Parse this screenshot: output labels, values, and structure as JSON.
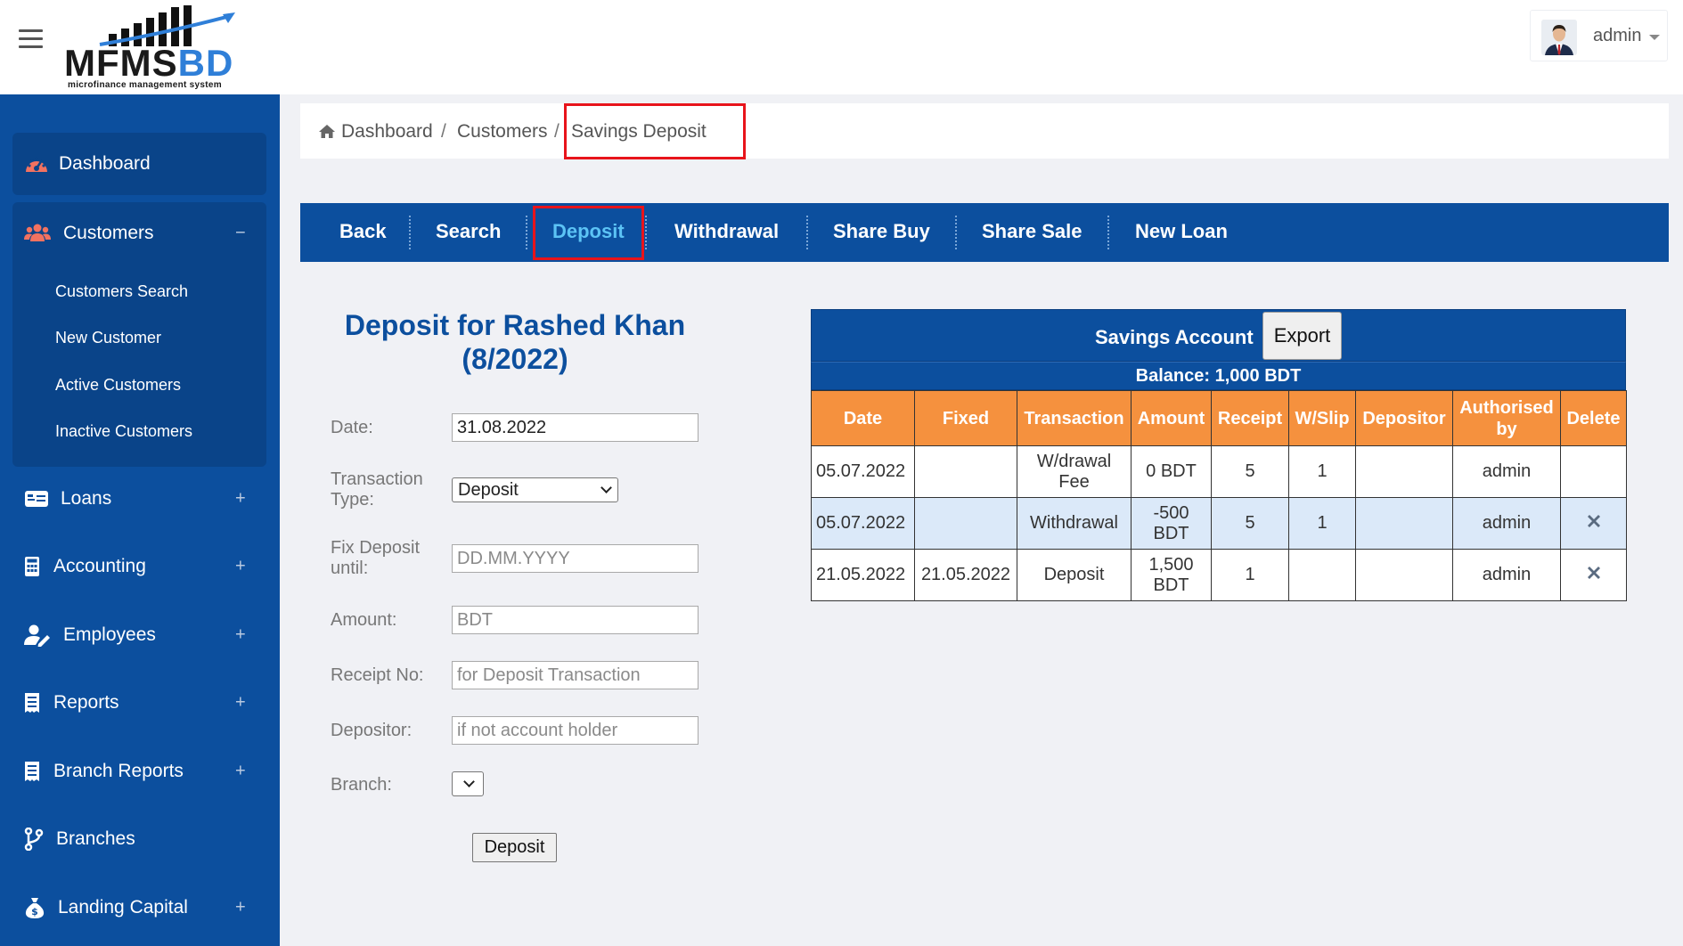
{
  "header": {
    "logo_main_dark": "MFMS",
    "logo_main_blue": "BD",
    "logo_sub": "microfinance management system",
    "user_name": "admin"
  },
  "sidebar": {
    "dashboard": "Dashboard",
    "customers": "Customers",
    "customers_toggle": "−",
    "customer_sub": [
      "Customers Search",
      "New Customer",
      "Active Customers",
      "Inactive Customers"
    ],
    "items": [
      {
        "label": "Loans",
        "toggle": "+"
      },
      {
        "label": "Accounting",
        "toggle": "+"
      },
      {
        "label": "Employees",
        "toggle": "+"
      },
      {
        "label": "Reports",
        "toggle": "+"
      },
      {
        "label": "Branch Reports",
        "toggle": "+"
      },
      {
        "label": "Branches",
        "toggle": ""
      },
      {
        "label": "Landing Capital",
        "toggle": "+"
      }
    ]
  },
  "breadcrumb": {
    "home": "Dashboard",
    "sep": "/",
    "customers": "Customers",
    "current": "Savings Deposit"
  },
  "actions": [
    "Back",
    "Search",
    "Deposit",
    "Withdrawal",
    "Share Buy",
    "Share Sale",
    "New Loan"
  ],
  "form": {
    "title_line1": "Deposit for Rashed Khan",
    "title_line2": "(8/2022)",
    "date_label": "Date:",
    "date_value": "31.08.2022",
    "type_label_1": "Transaction",
    "type_label_2": "Type:",
    "type_value": "Deposit",
    "fix_label_1": "Fix Deposit",
    "fix_label_2": "until:",
    "fix_placeholder": "DD.MM.YYYY",
    "amount_label": "Amount:",
    "amount_placeholder": "BDT",
    "receipt_label": "Receipt No:",
    "receipt_placeholder": "for Deposit Transaction",
    "depositor_label": "Depositor:",
    "depositor_placeholder": "if not account holder",
    "branch_label": "Branch:",
    "submit_label": "Deposit"
  },
  "savings": {
    "title": "Savings Account",
    "export_label": "Export",
    "balance": "Balance: 1,000 BDT",
    "columns": [
      "Date",
      "Fixed",
      "Transaction",
      "Amount",
      "Receipt",
      "W/Slip",
      "Depositor",
      "Authorised by",
      "Delete"
    ],
    "rows": [
      {
        "date": "05.07.2022",
        "fixed": "",
        "transaction": "W/drawal Fee",
        "amount": "0 BDT",
        "receipt": "5",
        "wslip": "1",
        "depositor": "",
        "authorised": "admin",
        "delete": false
      },
      {
        "date": "05.07.2022",
        "fixed": "",
        "transaction": "Withdrawal",
        "amount": "-500 BDT",
        "receipt": "5",
        "wslip": "1",
        "depositor": "",
        "authorised": "admin",
        "delete": true
      },
      {
        "date": "21.05.2022",
        "fixed": "21.05.2022",
        "transaction": "Deposit",
        "amount": "1,500 BDT",
        "receipt": "1",
        "wslip": "",
        "depositor": "",
        "authorised": "admin",
        "delete": true
      }
    ]
  },
  "colors": {
    "primary": "#0c4f9e",
    "primary_dark": "#0a4489",
    "accent_orange": "#f5913e",
    "active_link": "#5cc3f5",
    "highlight_red": "#e8141b",
    "row_alt": "#dbe9f9"
  }
}
